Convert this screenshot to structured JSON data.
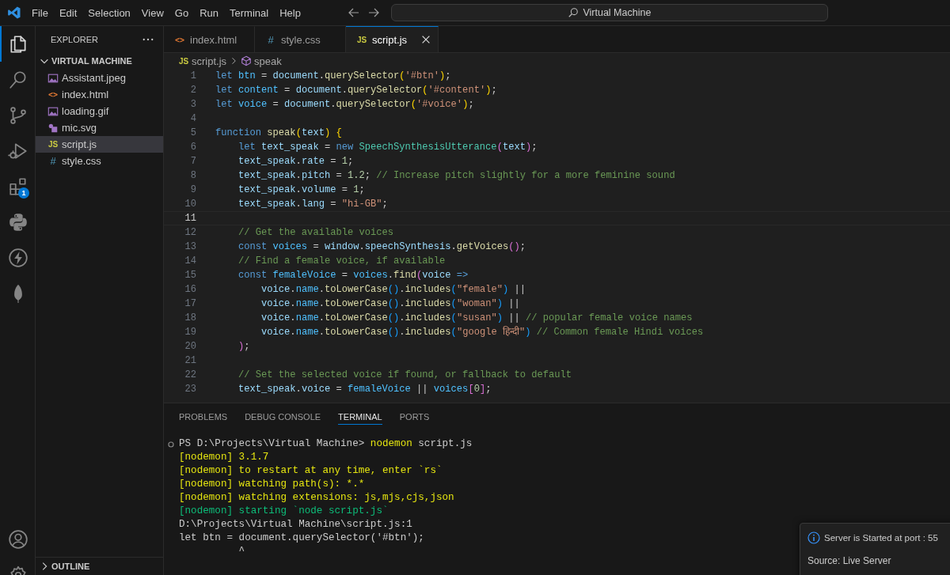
{
  "menu": [
    "File",
    "Edit",
    "Selection",
    "View",
    "Go",
    "Run",
    "Terminal",
    "Help"
  ],
  "command_center": {
    "label": "Virtual Machine"
  },
  "activity_bar": [
    {
      "kind": "explorer",
      "selected": true
    },
    {
      "kind": "search",
      "selected": false
    },
    {
      "kind": "source-control",
      "selected": false
    },
    {
      "kind": "run",
      "selected": false
    },
    {
      "kind": "extensions",
      "selected": false,
      "badge": "1"
    },
    {
      "kind": "python",
      "selected": false
    },
    {
      "kind": "bolt",
      "selected": false
    },
    {
      "kind": "leaf",
      "selected": false
    }
  ],
  "activity_bottom": [
    {
      "kind": "account"
    },
    {
      "kind": "settings"
    }
  ],
  "sidebar": {
    "title": "EXPLORER",
    "folder": {
      "name": "VIRTUAL MACHINE",
      "expanded": true,
      "children": [
        {
          "name": "Assistant.jpeg",
          "kind": "image",
          "selected": false
        },
        {
          "name": "index.html",
          "kind": "html",
          "icon": "<>",
          "selected": false
        },
        {
          "name": "loading.gif",
          "kind": "image",
          "selected": false
        },
        {
          "name": "mic.svg",
          "kind": "svg",
          "selected": false
        },
        {
          "name": "script.js",
          "kind": "js",
          "icon": "JS",
          "selected": true
        },
        {
          "name": "style.css",
          "kind": "css",
          "icon": "#",
          "selected": false
        }
      ]
    },
    "outline": {
      "name": "OUTLINE",
      "expanded": false
    }
  },
  "tabs": [
    {
      "label": "index.html",
      "kind": "html",
      "icon": "<>",
      "selected": false
    },
    {
      "label": "style.css",
      "kind": "css",
      "icon": "#",
      "selected": false
    },
    {
      "label": "script.js",
      "kind": "js",
      "icon": "JS",
      "selected": true
    }
  ],
  "breadcrumb": [
    {
      "label": "script.js",
      "kind": "js",
      "icon": "JS"
    },
    {
      "label": "speak",
      "kind": "symbol"
    }
  ],
  "code": [
    {
      "number": "1",
      "current": false,
      "tokens": [
        {
          "kind": "kw",
          "text": "let "
        },
        {
          "kind": "const",
          "text": "btn"
        },
        {
          "kind": "p",
          "text": " = "
        },
        {
          "kind": "var",
          "text": "document"
        },
        {
          "kind": "p",
          "text": "."
        },
        {
          "kind": "fn",
          "text": "querySelector"
        },
        {
          "kind": "b1",
          "text": "("
        },
        {
          "kind": "str",
          "text": "'#btn'"
        },
        {
          "kind": "b1",
          "text": ")"
        },
        {
          "kind": "p",
          "text": ";"
        }
      ]
    },
    {
      "number": "2",
      "current": false,
      "tokens": [
        {
          "kind": "kw",
          "text": "let "
        },
        {
          "kind": "const",
          "text": "content"
        },
        {
          "kind": "p",
          "text": " = "
        },
        {
          "kind": "var",
          "text": "document"
        },
        {
          "kind": "p",
          "text": "."
        },
        {
          "kind": "fn",
          "text": "querySelector"
        },
        {
          "kind": "b1",
          "text": "("
        },
        {
          "kind": "str",
          "text": "'#content'"
        },
        {
          "kind": "b1",
          "text": ")"
        },
        {
          "kind": "p",
          "text": ";"
        }
      ]
    },
    {
      "number": "3",
      "current": false,
      "tokens": [
        {
          "kind": "kw",
          "text": "let "
        },
        {
          "kind": "const",
          "text": "voice"
        },
        {
          "kind": "p",
          "text": " = "
        },
        {
          "kind": "var",
          "text": "document"
        },
        {
          "kind": "p",
          "text": "."
        },
        {
          "kind": "fn",
          "text": "querySelector"
        },
        {
          "kind": "b1",
          "text": "("
        },
        {
          "kind": "str",
          "text": "'#voice'"
        },
        {
          "kind": "b1",
          "text": ")"
        },
        {
          "kind": "p",
          "text": ";"
        }
      ]
    },
    {
      "number": "4",
      "current": false
    },
    {
      "number": "5",
      "current": false,
      "tokens": [
        {
          "kind": "kw",
          "text": "function "
        },
        {
          "kind": "fn",
          "text": "speak"
        },
        {
          "kind": "b1",
          "text": "("
        },
        {
          "kind": "var",
          "text": "text"
        },
        {
          "kind": "b1",
          "text": ") {"
        }
      ]
    },
    {
      "number": "6",
      "current": false,
      "tokens": [
        {
          "kind": "kw",
          "text": "    let "
        },
        {
          "kind": "var",
          "text": "text_speak"
        },
        {
          "kind": "p",
          "text": " = "
        },
        {
          "kind": "kw",
          "text": "new "
        },
        {
          "kind": "cls",
          "text": "SpeechSynthesisUtterance"
        },
        {
          "kind": "b2",
          "text": "("
        },
        {
          "kind": "var",
          "text": "text"
        },
        {
          "kind": "b2",
          "text": ")"
        },
        {
          "kind": "p",
          "text": ";"
        }
      ]
    },
    {
      "number": "7",
      "current": false,
      "tokens": [
        {
          "kind": "var",
          "text": "    text_speak"
        },
        {
          "kind": "p",
          "text": "."
        },
        {
          "kind": "var",
          "text": "rate"
        },
        {
          "kind": "p",
          "text": " = "
        },
        {
          "kind": "num",
          "text": "1"
        },
        {
          "kind": "p",
          "text": ";"
        }
      ]
    },
    {
      "number": "8",
      "current": false,
      "tokens": [
        {
          "kind": "var",
          "text": "    text_speak"
        },
        {
          "kind": "p",
          "text": "."
        },
        {
          "kind": "var",
          "text": "pitch"
        },
        {
          "kind": "p",
          "text": " = "
        },
        {
          "kind": "num",
          "text": "1.2"
        },
        {
          "kind": "p",
          "text": ";"
        },
        {
          "kind": "cmt",
          "text": " // Increase pitch slightly for a more feminine sound"
        }
      ]
    },
    {
      "number": "9",
      "current": false,
      "tokens": [
        {
          "kind": "var",
          "text": "    text_speak"
        },
        {
          "kind": "p",
          "text": "."
        },
        {
          "kind": "var",
          "text": "volume"
        },
        {
          "kind": "p",
          "text": " = "
        },
        {
          "kind": "num",
          "text": "1"
        },
        {
          "kind": "p",
          "text": ";"
        }
      ]
    },
    {
      "number": "10",
      "current": false,
      "tokens": [
        {
          "kind": "var",
          "text": "    text_speak"
        },
        {
          "kind": "p",
          "text": "."
        },
        {
          "kind": "var",
          "text": "lang"
        },
        {
          "kind": "p",
          "text": " = "
        },
        {
          "kind": "str",
          "text": "\"hi-GB\""
        },
        {
          "kind": "p",
          "text": ";"
        }
      ]
    },
    {
      "number": "11",
      "current": true
    },
    {
      "number": "12",
      "current": false,
      "tokens": [
        {
          "kind": "cmt",
          "text": "    // Get the available voices"
        }
      ]
    },
    {
      "number": "13",
      "current": false,
      "tokens": [
        {
          "kind": "kw",
          "text": "    const "
        },
        {
          "kind": "const",
          "text": "voices"
        },
        {
          "kind": "p",
          "text": " = "
        },
        {
          "kind": "var",
          "text": "window"
        },
        {
          "kind": "p",
          "text": "."
        },
        {
          "kind": "var",
          "text": "speechSynthesis"
        },
        {
          "kind": "p",
          "text": "."
        },
        {
          "kind": "fn",
          "text": "getVoices"
        },
        {
          "kind": "b2",
          "text": "()"
        },
        {
          "kind": "p",
          "text": ";"
        }
      ]
    },
    {
      "number": "14",
      "current": false,
      "tokens": [
        {
          "kind": "cmt",
          "text": "    // Find a female voice, if available"
        }
      ]
    },
    {
      "number": "15",
      "current": false,
      "tokens": [
        {
          "kind": "kw",
          "text": "    const "
        },
        {
          "kind": "const",
          "text": "femaleVoice"
        },
        {
          "kind": "p",
          "text": " = "
        },
        {
          "kind": "const",
          "text": "voices"
        },
        {
          "kind": "p",
          "text": "."
        },
        {
          "kind": "fn",
          "text": "find"
        },
        {
          "kind": "b2",
          "text": "("
        },
        {
          "kind": "var",
          "text": "voice"
        },
        {
          "kind": "kw",
          "text": " =>"
        }
      ]
    },
    {
      "number": "16",
      "current": false,
      "tokens": [
        {
          "kind": "var",
          "text": "        voice"
        },
        {
          "kind": "p",
          "text": "."
        },
        {
          "kind": "const",
          "text": "name"
        },
        {
          "kind": "p",
          "text": "."
        },
        {
          "kind": "fn",
          "text": "toLowerCase"
        },
        {
          "kind": "b3",
          "text": "()"
        },
        {
          "kind": "p",
          "text": "."
        },
        {
          "kind": "fn",
          "text": "includes"
        },
        {
          "kind": "b3",
          "text": "("
        },
        {
          "kind": "str",
          "text": "\"female\""
        },
        {
          "kind": "b3",
          "text": ")"
        },
        {
          "kind": "p",
          "text": " ||"
        }
      ]
    },
    {
      "number": "17",
      "current": false,
      "tokens": [
        {
          "kind": "var",
          "text": "        voice"
        },
        {
          "kind": "p",
          "text": "."
        },
        {
          "kind": "const",
          "text": "name"
        },
        {
          "kind": "p",
          "text": "."
        },
        {
          "kind": "fn",
          "text": "toLowerCase"
        },
        {
          "kind": "b3",
          "text": "()"
        },
        {
          "kind": "p",
          "text": "."
        },
        {
          "kind": "fn",
          "text": "includes"
        },
        {
          "kind": "b3",
          "text": "("
        },
        {
          "kind": "str",
          "text": "\"woman\""
        },
        {
          "kind": "b3",
          "text": ")"
        },
        {
          "kind": "p",
          "text": " ||"
        }
      ]
    },
    {
      "number": "18",
      "current": false,
      "tokens": [
        {
          "kind": "var",
          "text": "        voice"
        },
        {
          "kind": "p",
          "text": "."
        },
        {
          "kind": "const",
          "text": "name"
        },
        {
          "kind": "p",
          "text": "."
        },
        {
          "kind": "fn",
          "text": "toLowerCase"
        },
        {
          "kind": "b3",
          "text": "()"
        },
        {
          "kind": "p",
          "text": "."
        },
        {
          "kind": "fn",
          "text": "includes"
        },
        {
          "kind": "b3",
          "text": "("
        },
        {
          "kind": "str",
          "text": "\"susan\""
        },
        {
          "kind": "b3",
          "text": ")"
        },
        {
          "kind": "p",
          "text": " ||"
        },
        {
          "kind": "cmt",
          "text": " // popular female voice names"
        }
      ]
    },
    {
      "number": "19",
      "current": false,
      "tokens": [
        {
          "kind": "var",
          "text": "        voice"
        },
        {
          "kind": "p",
          "text": "."
        },
        {
          "kind": "const",
          "text": "name"
        },
        {
          "kind": "p",
          "text": "."
        },
        {
          "kind": "fn",
          "text": "toLowerCase"
        },
        {
          "kind": "b3",
          "text": "()"
        },
        {
          "kind": "p",
          "text": "."
        },
        {
          "kind": "fn",
          "text": "includes"
        },
        {
          "kind": "b3",
          "text": "("
        },
        {
          "kind": "str",
          "text": "\"google हिन्दी\""
        },
        {
          "kind": "b3",
          "text": ")"
        },
        {
          "kind": "cmt",
          "text": " // Common female Hindi voices"
        }
      ]
    },
    {
      "number": "20",
      "current": false,
      "tokens": [
        {
          "kind": "b2",
          "text": "    )"
        },
        {
          "kind": "p",
          "text": ";"
        }
      ]
    },
    {
      "number": "21",
      "current": false
    },
    {
      "number": "22",
      "current": false,
      "tokens": [
        {
          "kind": "cmt",
          "text": "    // Set the selected voice if found, or fallback to default"
        }
      ]
    },
    {
      "number": "23",
      "current": false,
      "tokens": [
        {
          "kind": "var",
          "text": "    text_speak"
        },
        {
          "kind": "p",
          "text": "."
        },
        {
          "kind": "var",
          "text": "voice"
        },
        {
          "kind": "p",
          "text": " = "
        },
        {
          "kind": "const",
          "text": "femaleVoice"
        },
        {
          "kind": "p",
          "text": " || "
        },
        {
          "kind": "const",
          "text": "voices"
        },
        {
          "kind": "b2",
          "text": "["
        },
        {
          "kind": "num",
          "text": "0"
        },
        {
          "kind": "b2",
          "text": "]"
        },
        {
          "kind": "p",
          "text": ";"
        }
      ]
    }
  ],
  "panel_tabs": [
    {
      "label": "PROBLEMS",
      "selected": false
    },
    {
      "label": "DEBUG CONSOLE",
      "selected": false
    },
    {
      "label": "TERMINAL",
      "selected": true
    },
    {
      "label": "PORTS",
      "selected": false
    }
  ],
  "terminal": [
    {
      "marker": true,
      "tokens": [
        {
          "kind": "plain",
          "text": "PS D:\\Projects\\Virtual Machine> "
        },
        {
          "kind": "command",
          "text": "nodemon"
        },
        {
          "kind": "plain",
          "text": " script.js"
        }
      ]
    },
    {
      "marker": false,
      "tokens": [
        {
          "kind": "yellow",
          "text": "[nodemon] 3.1.7"
        }
      ]
    },
    {
      "marker": false,
      "tokens": [
        {
          "kind": "yellow",
          "text": "[nodemon] to restart at any time, enter `rs`"
        }
      ]
    },
    {
      "marker": false,
      "tokens": [
        {
          "kind": "yellow",
          "text": "[nodemon] watching path(s): *.*"
        }
      ]
    },
    {
      "marker": false,
      "tokens": [
        {
          "kind": "yellow",
          "text": "[nodemon] watching extensions: js,mjs,cjs,json"
        }
      ]
    },
    {
      "marker": false,
      "tokens": [
        {
          "kind": "green",
          "text": "[nodemon] starting `node script.js`"
        }
      ]
    },
    {
      "marker": false,
      "tokens": [
        {
          "kind": "plain",
          "text": "D:\\Projects\\Virtual Machine\\script.js:1"
        }
      ]
    },
    {
      "marker": false,
      "tokens": [
        {
          "kind": "plain",
          "text": "let btn = document.querySelector('#btn');"
        }
      ]
    },
    {
      "marker": false,
      "tokens": [
        {
          "kind": "plain",
          "text": "          ^"
        }
      ]
    }
  ],
  "notification": {
    "message": "Server is Started at port : 55",
    "source": "Source: Live Server"
  }
}
